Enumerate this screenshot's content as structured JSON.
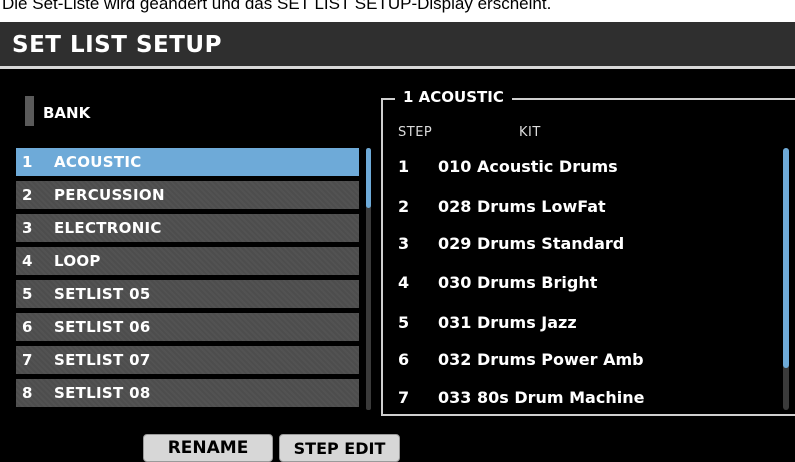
{
  "caption": "Die Set-Liste wird geändert und das SET LIST SETUP-Display erscheint.",
  "header": {
    "title": "SET LIST SETUP"
  },
  "bank": {
    "label": "BANK"
  },
  "bank_list": {
    "items": [
      {
        "num": "1",
        "name": "ACOUSTIC"
      },
      {
        "num": "2",
        "name": "PERCUSSION"
      },
      {
        "num": "3",
        "name": "ELECTRONIC"
      },
      {
        "num": "4",
        "name": "LOOP"
      },
      {
        "num": "5",
        "name": "SETLIST 05"
      },
      {
        "num": "6",
        "name": "SETLIST 06"
      },
      {
        "num": "7",
        "name": "SETLIST 07"
      },
      {
        "num": "8",
        "name": "SETLIST 08"
      }
    ],
    "selected_index": 0
  },
  "kit_panel": {
    "title": "1 ACOUSTIC",
    "columns": {
      "step": "STEP",
      "kit": "KIT"
    },
    "rows": [
      {
        "step": "1",
        "kit": "010 Acoustic Drums"
      },
      {
        "step": "2",
        "kit": "028 Drums LowFat"
      },
      {
        "step": "3",
        "kit": "029 Drums Standard"
      },
      {
        "step": "4",
        "kit": "030 Drums Bright"
      },
      {
        "step": "5",
        "kit": "031 Drums Jazz"
      },
      {
        "step": "6",
        "kit": "032 Drums Power Amb"
      },
      {
        "step": "7",
        "kit": "033 80s Drum Machine"
      }
    ]
  },
  "buttons": {
    "rename": "RENAME",
    "step_edit": "STEP EDIT"
  },
  "colors": {
    "accent": "#6eaad8",
    "background": "#000000",
    "item_bg": "#4d4d4d"
  }
}
